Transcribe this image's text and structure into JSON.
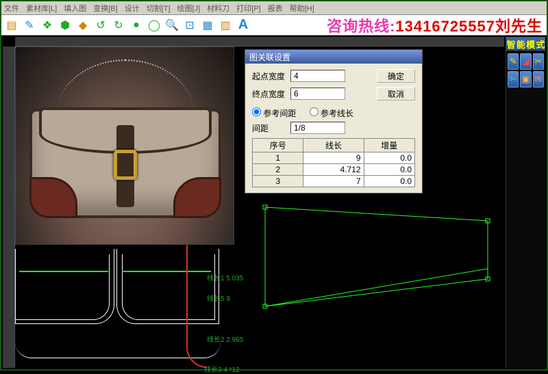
{
  "menu": {
    "items": [
      "文件",
      "素材库[L]",
      "填入图",
      "变换[B]",
      "设计",
      "切割[T]",
      "绘图[J]",
      "材料刀",
      "打印[P]",
      "报表",
      "帮助[H]"
    ]
  },
  "toolbar": {
    "icons": [
      "new",
      "open",
      "save",
      "import",
      "dxf",
      "undo",
      "redo",
      "circle",
      "ring",
      "zoom",
      "fit",
      "layer",
      "grid",
      "text-a"
    ]
  },
  "hotline": {
    "label": "咨询热线:",
    "number": "13416725557",
    "name": "刘先生"
  },
  "side": {
    "title": [
      "智",
      "能",
      "模",
      "式"
    ],
    "buttons": [
      "pencil",
      "triangle",
      "compass",
      "scissors",
      "box",
      "envelope"
    ]
  },
  "dialog": {
    "title": "图关联设置",
    "start_label": "起点宽度",
    "start_value": "4",
    "end_label": "终点宽度",
    "end_value": "6",
    "ok": "确定",
    "cancel": "取消",
    "radio_dist": "参考间距",
    "radio_len": "参考线长",
    "gap_label": "间距",
    "gap_value": "1/8",
    "cols": [
      "序号",
      "线长",
      "增量"
    ],
    "rows": [
      {
        "n": "1",
        "len": "9",
        "inc": "0.0"
      },
      {
        "n": "2",
        "len": "4.712",
        "inc": "0.0"
      },
      {
        "n": "3",
        "len": "7",
        "inc": "0.0"
      }
    ]
  },
  "annotations": {
    "a1": "线长1 5.035",
    "a2": "线长5 9",
    "a3": "线长2 2.965",
    "a4": "线长3 4 *12"
  }
}
